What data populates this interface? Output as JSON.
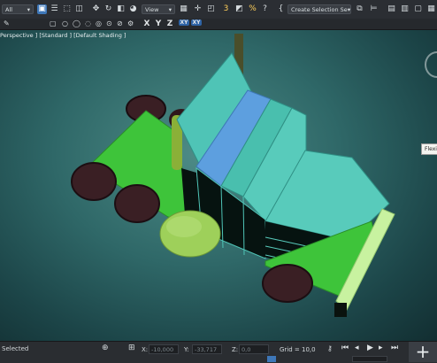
{
  "toolbar": {
    "filter_dropdown": "All",
    "view_dropdown": "View",
    "angle_snap_label": "3",
    "percent_snap_label": "%",
    "spinner_snap_label": "?",
    "selection_set_dropdown": "Create Selection Se",
    "axis_x": "X",
    "axis_y": "Y",
    "axis_z": "Z",
    "axis_xy": "XY",
    "axis_xy2": "XY"
  },
  "viewport": {
    "label": "Perspective ] [Standard ] [Default Shading ]",
    "tooltip": "Flexi"
  },
  "status": {
    "selected_label": "Selected",
    "x_label": "X:",
    "x_value": "-10,000",
    "y_label": "Y:",
    "y_value": "-33,717",
    "z_label": "Z:",
    "z_value": "0,0",
    "grid_label": "Grid = 10,0"
  },
  "colors": {
    "truck_cab": "#4fc4b6",
    "truck_green": "#3ec43a",
    "stripe_blue": "#5d9fdf",
    "wheel": "#3a1f24",
    "viewport_bg": "#2f6868"
  }
}
